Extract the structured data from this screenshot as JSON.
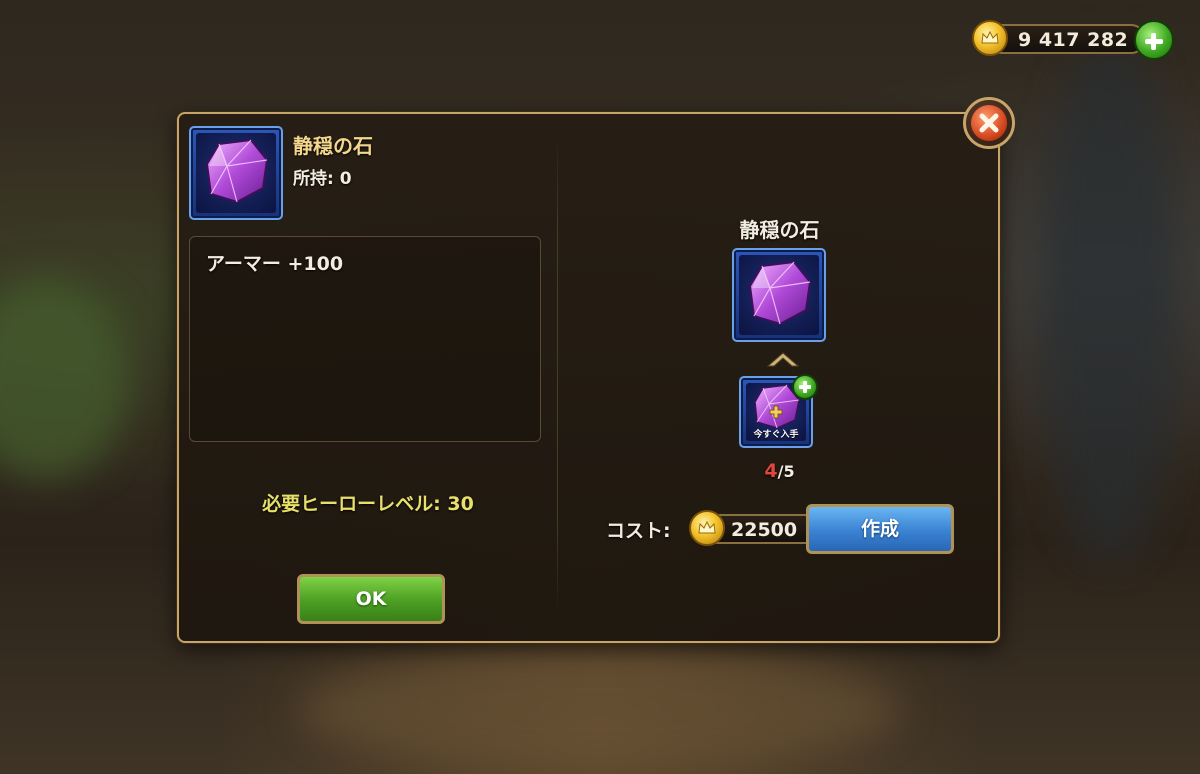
{
  "currency": {
    "gold_amount": "9 417 282",
    "coin_icon": "gold-coin-icon",
    "add_icon": "plus-icon"
  },
  "item": {
    "name": "静穏の石",
    "owned_label": "所持: 0",
    "icon": "purple-gem-icon",
    "description": "アーマー +100",
    "required_level": "必要ヒーローレベル: 30"
  },
  "buttons": {
    "ok": "OK",
    "craft": "作成",
    "close_icon": "close-icon"
  },
  "crafting": {
    "result_name": "静穏の石",
    "result_icon": "purple-gem-icon",
    "arrow_icon": "chevron-up-icon",
    "material_icon": "gem-fragment-icon",
    "material_label": "今すぐ入手",
    "material_current": "4",
    "material_required": "/5",
    "cost_label": "コスト:",
    "cost_value": "22500"
  },
  "colors": {
    "title": "#f4d78c",
    "required_level": "#e8e06a",
    "progress_current": "#e0473a",
    "ok_button": "#4c9e24",
    "craft_button": "#3a82d2",
    "frame_border": "#c7a46a"
  }
}
